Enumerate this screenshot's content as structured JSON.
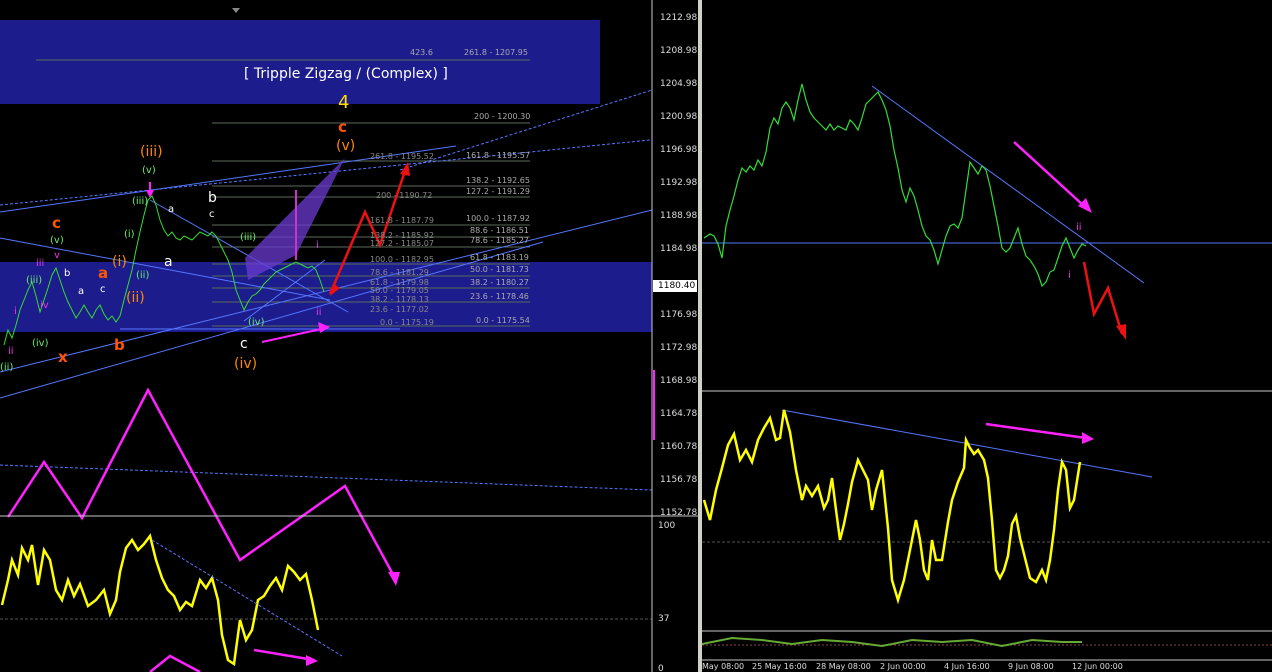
{
  "left_chart": {
    "title_box_text": "[ Tripple Zigzag / (Complex) ]",
    "price_axis": [
      "1212.98",
      "1208.98",
      "1204.98",
      "1200.98",
      "1196.98",
      "1192.98",
      "1188.98",
      "1184.98",
      "1180.98",
      "1176.98",
      "1172.98",
      "1168.98",
      "1164.78",
      "1160.78",
      "1156.78",
      "1152.78"
    ],
    "current_price": "1180.40",
    "osc_axis": [
      "100",
      "37",
      "0"
    ],
    "fib_labels_upper": [
      "423.6",
      "261.8 - 1207.95",
      "200 - 1200.30",
      "161.8 - 1195.57",
      "138.2 - 1192.65",
      "127.2 - 1191.29",
      "100.0 - 1187.92",
      "88.6 - 1186.51",
      "78.6 - 1185.27",
      "61.8 - 1183.19",
      "50.0 - 1181.73",
      "38.2 - 1180.27",
      "23.6 - 1178.46",
      "0.0 - 1175.54"
    ],
    "fib_labels_mid": [
      "261.8 - 1195.52",
      "200 - 1190.72",
      "161.8 - 1187.79",
      "138.2 - 1185.92",
      "127.2 - 1185.07",
      "100.0 - 1182.95",
      "78.6 - 1181.29",
      "61.8 - 1179.98",
      "50.0 - 1179.05",
      "38.2 - 1178.13",
      "23.6 - 1177.02",
      "0.0 - 1175.19"
    ],
    "wave_labels": {
      "w4": "4",
      "c_top": "c",
      "v_top": "(v)",
      "iii_top": "(iii)",
      "v_small": "(v)",
      "iii_small": "(iii)",
      "iv_small": "(iv)",
      "b_white": "b",
      "c_white": "c",
      "a_white": "a",
      "a2_white": "a",
      "iii_paren": "(iii)",
      "iv_bottom": "(iv)",
      "c_bottom": "c",
      "iv_orange": "(iv)",
      "c_left_orange": "c",
      "v_left": "(v)",
      "a_orange": "a",
      "b_orange": "b",
      "x_orange": "x",
      "i_paren": "(i)",
      "ii_paren": "(ii)",
      "i_green": "(i)",
      "ii_green": "(ii)",
      "iii_green": "(iii)",
      "iv_green": "(iv)",
      "ii_lower": "(ii)",
      "i_magenta": "i",
      "ii_magenta": "ii",
      "iii_magenta": "iii",
      "iv_magenta": "iv",
      "v_magenta": "v",
      "b_small": "b",
      "c_small": "c",
      "a_small": "a",
      "ii_right": "ii",
      "i_right": "i"
    }
  },
  "right_chart": {
    "time_axis": [
      "May 08:00",
      "25 May 16:00",
      "28 May 08:00",
      "2 Jun 00:00",
      "4 Jun 16:00",
      "9 Jun 08:00",
      "12 Jun 00:00"
    ],
    "wave_labels": {
      "ii": "ii",
      "i": "i"
    }
  },
  "colors": {
    "background": "#000000",
    "fib_band": "#1c1c8c",
    "candle": "#33dd33",
    "oscillator": "#ffff00",
    "arrow_magenta": "#ff22ff",
    "arrow_red": "#ee1111",
    "trendline": "#5577ff",
    "wave_orange": "#ff5500",
    "wave_yellow": "#ffdd00",
    "wave_green": "#66ee66",
    "wave_magenta": "#ee33ee"
  }
}
